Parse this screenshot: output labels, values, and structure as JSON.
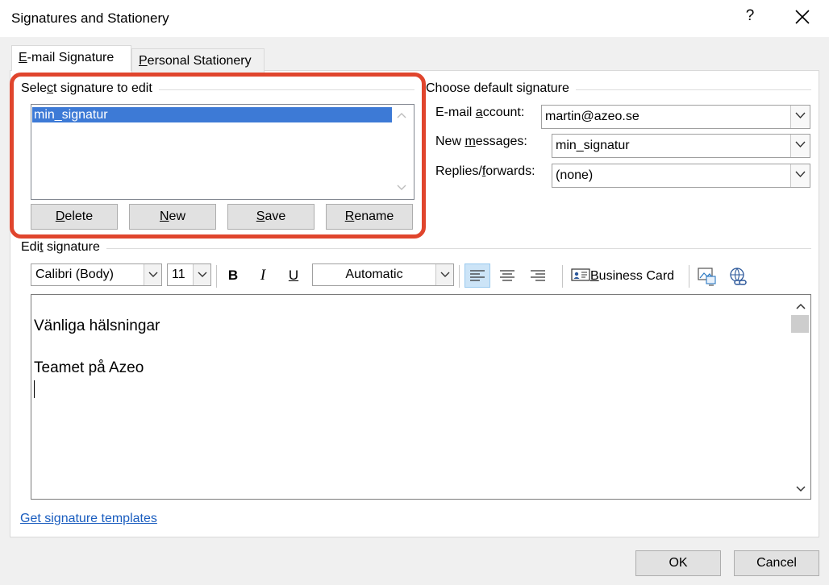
{
  "window": {
    "title": "Signatures and Stationery",
    "help_glyph": "?",
    "close_icon": "close-icon"
  },
  "tabs": [
    {
      "label_pre": "",
      "label_u": "E",
      "label_post": "-mail Signature",
      "selected": true
    },
    {
      "label_pre": "",
      "label_u": "P",
      "label_post": "ersonal Stationery",
      "selected": false
    }
  ],
  "select_signature": {
    "group_label_pre": "Sele",
    "group_label_u": "c",
    "group_label_post": "t signature to edit",
    "items": [
      "min_signatur"
    ],
    "selected": "min_signatur",
    "buttons": [
      {
        "pre": "",
        "u": "D",
        "post": "elete"
      },
      {
        "pre": "",
        "u": "N",
        "post": "ew"
      },
      {
        "pre": "",
        "u": "S",
        "post": "ave"
      },
      {
        "pre": "",
        "u": "R",
        "post": "ename"
      }
    ],
    "highlight_color": "#e0452d"
  },
  "default_signature": {
    "group_label": "Choose default signature",
    "email_account": {
      "label_pre": "E-mail ",
      "label_u": "a",
      "label_post": "ccount:",
      "value": "martin@azeo.se"
    },
    "new_messages": {
      "label_pre": "New ",
      "label_u": "m",
      "label_post": "essages:",
      "value": "min_signatur"
    },
    "replies": {
      "label_pre": "Replies/",
      "label_u": "f",
      "label_post": "orwards:",
      "value": "(none)"
    }
  },
  "edit_signature": {
    "group_label_pre": "Edi",
    "group_label_u": "t",
    "group_label_post": " signature",
    "font": "Calibri (Body)",
    "size": "11",
    "bold": "B",
    "italic": "I",
    "underline": "U",
    "color": "Automatic",
    "business_card_u": "B",
    "business_card_post": "usiness Card",
    "content": [
      "Vänliga hälsningar",
      "",
      "Teamet på Azeo"
    ]
  },
  "footer": {
    "templates_link": "Get signature templates",
    "ok": "OK",
    "cancel": "Cancel"
  },
  "colors": {
    "selection": "#3d7ad6",
    "link": "#1a5dbf",
    "align_active_bg": "#cce4f7"
  }
}
